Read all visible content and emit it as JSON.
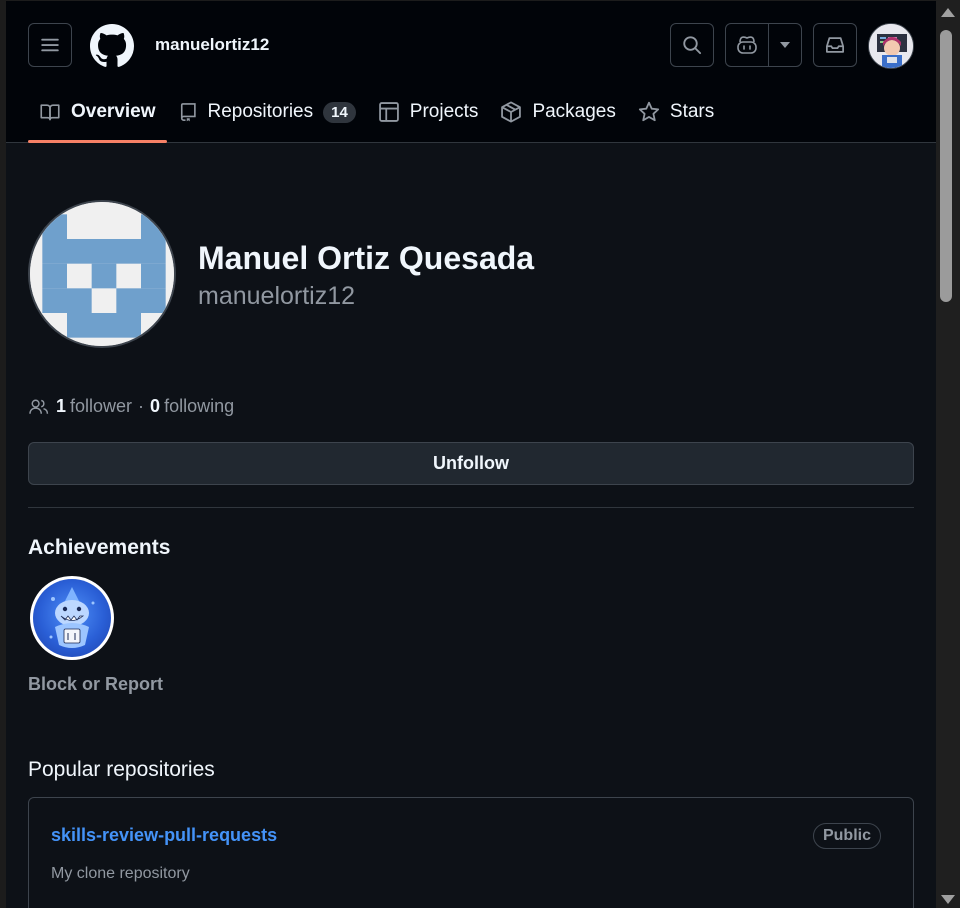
{
  "header": {
    "username": "manuelortiz12",
    "icons": [
      "hamburger-menu-icon",
      "github-logo-icon",
      "search-icon",
      "copilot-icon",
      "triangle-down-icon",
      "inbox-icon",
      "user-avatar"
    ]
  },
  "tabs": [
    {
      "label": "Overview",
      "icon": "book-icon",
      "active": true
    },
    {
      "label": "Repositories",
      "icon": "repo-icon",
      "count": "14"
    },
    {
      "label": "Projects",
      "icon": "table-icon"
    },
    {
      "label": "Packages",
      "icon": "package-icon"
    },
    {
      "label": "Stars",
      "icon": "star-icon"
    }
  ],
  "profile": {
    "full_name": "Manuel Ortiz Quesada",
    "username": "manuelortiz12",
    "followers_count": "1",
    "followers_label": "follower",
    "separator": "·",
    "following_count": "0",
    "following_label": "following",
    "unfollow_label": "Unfollow"
  },
  "achievements": {
    "title": "Achievements",
    "badge": "pull-shark-badge",
    "block_label": "Block or Report"
  },
  "popular": {
    "title": "Popular repositories",
    "repos": [
      {
        "name": "skills-review-pull-requests",
        "visibility": "Public",
        "description": "My clone repository"
      }
    ]
  },
  "colors": {
    "background": "#0d1117",
    "header_bg": "#010409",
    "accent_underline": "#f78166",
    "link": "#4493f8",
    "identicon": "#6fa0cc"
  }
}
